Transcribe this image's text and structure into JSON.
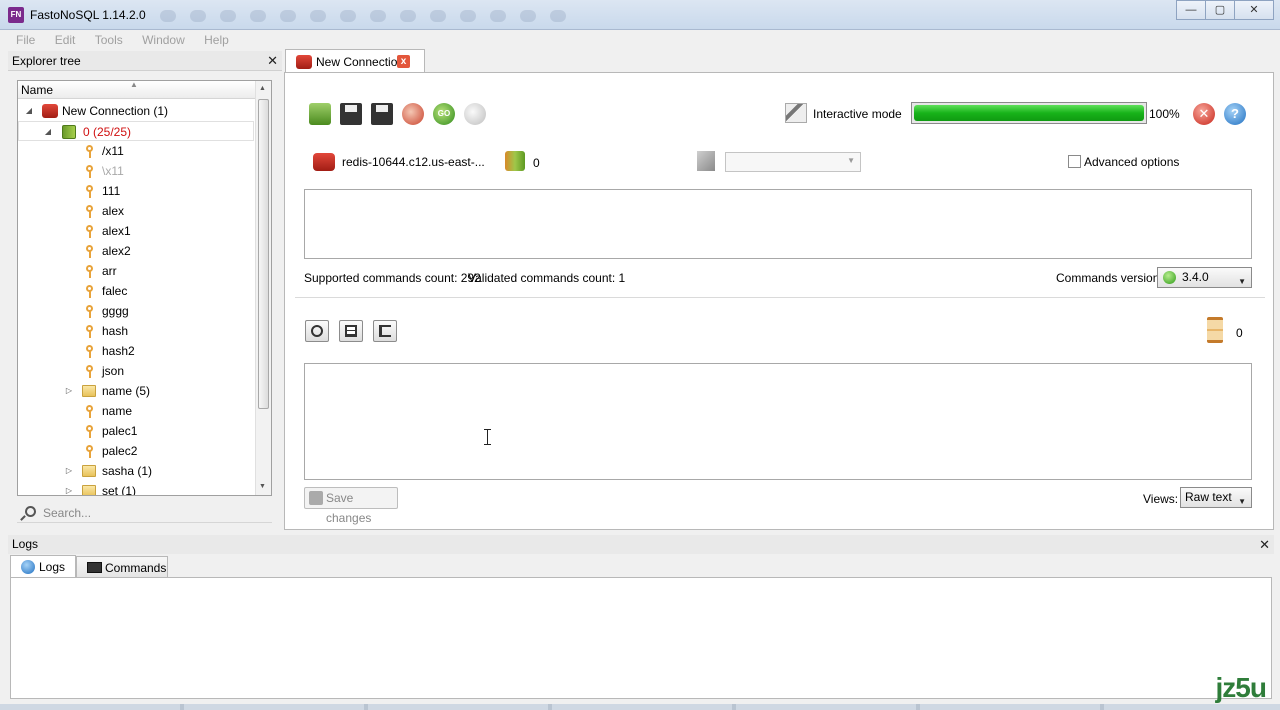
{
  "window": {
    "title": "FastoNoSQL 1.14.2.0",
    "app_icon_text": "FN",
    "minimize": "—",
    "maximize": "▢",
    "close": "✕"
  },
  "menu": [
    "File",
    "Edit",
    "Tools",
    "Window",
    "Help"
  ],
  "explorer": {
    "title": "Explorer tree",
    "column_header": "Name",
    "connection_label": "New Connection (1)",
    "database_label": "0 (25/25)",
    "items": [
      {
        "label": "/x11",
        "type": "key",
        "dim": false
      },
      {
        "label": "\\x11",
        "type": "key",
        "dim": true
      },
      {
        "label": "111",
        "type": "key",
        "dim": false
      },
      {
        "label": "alex",
        "type": "key",
        "dim": false
      },
      {
        "label": "alex1",
        "type": "key",
        "dim": false
      },
      {
        "label": "alex2",
        "type": "key",
        "dim": false
      },
      {
        "label": "arr",
        "type": "key",
        "dim": false
      },
      {
        "label": "falec",
        "type": "key",
        "dim": false
      },
      {
        "label": "gggg",
        "type": "key",
        "dim": false
      },
      {
        "label": "hash",
        "type": "key",
        "dim": false
      },
      {
        "label": "hash2",
        "type": "key",
        "dim": false
      },
      {
        "label": "json",
        "type": "key",
        "dim": false
      },
      {
        "label": "name (5)",
        "type": "folder",
        "dim": false
      },
      {
        "label": "name",
        "type": "key",
        "dim": false
      },
      {
        "label": "palec1",
        "type": "key",
        "dim": false
      },
      {
        "label": "palec2",
        "type": "key",
        "dim": false
      },
      {
        "label": "sasha (1)",
        "type": "folder",
        "dim": false
      },
      {
        "label": "set (1)",
        "type": "folder",
        "dim": false
      }
    ],
    "search_placeholder": "Search..."
  },
  "main_tab": {
    "label": "New Connection",
    "close": "x"
  },
  "toolbar": {
    "interactive_mode_label": "Interactive mode",
    "progress_percent": 100,
    "progress_label": "100%",
    "go_label": "GO",
    "help_label": "?",
    "close_label": "✕"
  },
  "connection": {
    "server_label": "redis-10644.c12.us-east-...",
    "db_count": "0",
    "advanced_options_label": "Advanced options"
  },
  "commands": {
    "supported_label": "Supported commands count: 292",
    "validated_label": "Validated commands count: 1",
    "version_label": "Commands version:",
    "version_value": "3.4.0"
  },
  "output": {
    "timer_value": "0",
    "save_changes_label": "Save changes",
    "views_label": "Views:",
    "views_value": "Raw text"
  },
  "logs": {
    "title": "Logs",
    "tabs": [
      "Logs",
      "Commands"
    ]
  },
  "watermark": "jz5u",
  "colors": {
    "accent_green": "#18b31a",
    "redis_red": "#c8261a",
    "db_label_red": "#d01010",
    "watermark_green": "#2f7d3a"
  }
}
